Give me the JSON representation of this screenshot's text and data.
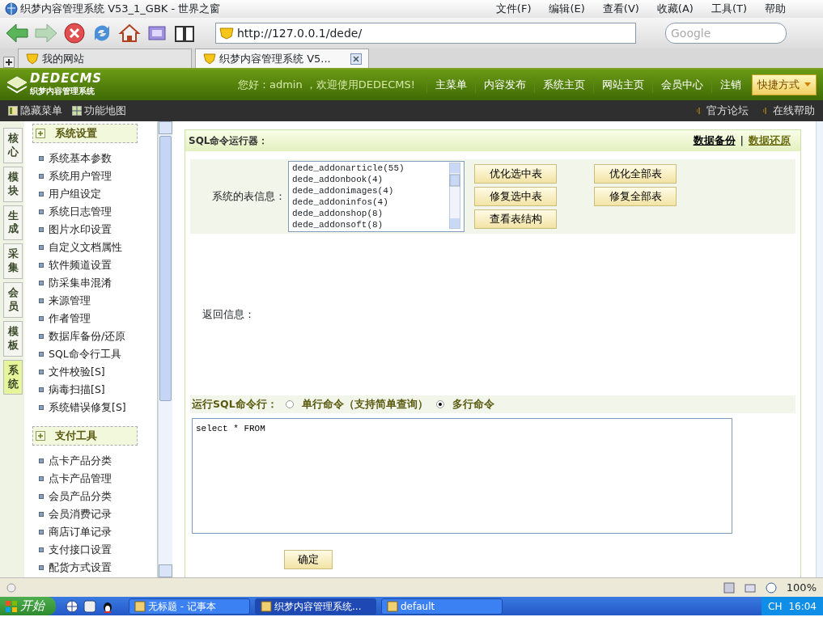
{
  "browser": {
    "title": "织梦内容管理系统 V53_1_GBK - 世界之窗",
    "menu": [
      "文件(F)",
      "编辑(E)",
      "查看(V)",
      "收藏(A)",
      "工具(T)",
      "帮助"
    ],
    "address": "http://127.0.0.1/dede/",
    "search_placeholder": "Google",
    "tabs": [
      {
        "label": "我的网站",
        "selected": false
      },
      {
        "label": "织梦内容管理系统 V5...",
        "selected": true
      }
    ]
  },
  "header": {
    "logo": "DEDECMS",
    "logo_subtitle": "织梦内容管理系统",
    "greeting": "您好：admin ，欢迎使用DEDECMS!",
    "nav": [
      "主菜单",
      "内容发布",
      "系统主页",
      "网站主页",
      "会员中心",
      "注销"
    ],
    "shortcut": "快捷方式",
    "subbar_left": [
      "隐藏菜单",
      "功能地图"
    ],
    "subbar_right": [
      "官方论坛",
      "在线帮助"
    ]
  },
  "side_tabs": [
    {
      "label": "核心",
      "selected": false
    },
    {
      "label": "模块",
      "selected": false
    },
    {
      "label": "生成",
      "selected": false
    },
    {
      "label": "采集",
      "selected": false
    },
    {
      "label": "会员",
      "selected": false
    },
    {
      "label": "模板",
      "selected": false
    },
    {
      "label": "系统",
      "selected": true
    }
  ],
  "menu_groups": [
    {
      "title": "系统设置",
      "items": [
        "系统基本参数",
        "系统用户管理",
        "用户组设定",
        "系统日志管理",
        "图片水印设置",
        "自定义文档属性",
        "软件频道设置",
        "防采集串混淆",
        "来源管理",
        "作者管理",
        "数据库备份/还原",
        "SQL命令行工具",
        "文件校验[S]",
        "病毒扫描[S]",
        "系统错误修复[S]"
      ]
    },
    {
      "title": "支付工具",
      "items": [
        "点卡产品分类",
        "点卡产品管理",
        "会员产品分类",
        "会员消费记录",
        "商店订单记录",
        "支付接口设置",
        "配货方式设置"
      ]
    }
  ],
  "panel": {
    "title": "SQL命令运行器：",
    "links": [
      "数据备份",
      "数据还原"
    ],
    "link_separator": "|",
    "table_label": "系统的表信息：",
    "tables": [
      "dede_addonarticle(55)",
      "dede_addonbook(4)",
      "dede_addonimages(4)",
      "dede_addoninfos(4)",
      "dede_addonshop(8)",
      "dede_addonsoft(8)"
    ],
    "buttons": [
      "优化选中表",
      "优化全部表",
      "修复选中表",
      "修复全部表",
      "查看表结构"
    ],
    "return_label": "返回信息：",
    "run_label": "运行SQL命令行：",
    "modes": [
      {
        "label": "单行命令（支持简单查询）",
        "selected": false
      },
      {
        "label": "多行命令",
        "selected": true
      }
    ],
    "sql": "select * FROM",
    "submit": "确定"
  },
  "status_bar": {
    "zoom": "100%"
  },
  "taskbar": {
    "start": "开始",
    "tasks": [
      {
        "label": "无标题 - 记事本",
        "selected": false
      },
      {
        "label": "织梦内容管理系统...",
        "selected": true
      },
      {
        "label": "default",
        "selected": false
      }
    ],
    "lang": "CH",
    "clock": "16:04"
  }
}
